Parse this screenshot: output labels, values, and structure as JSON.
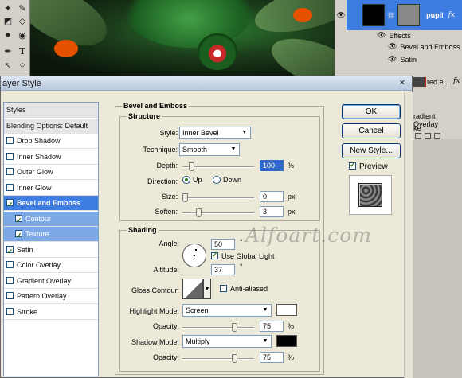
{
  "dialog": {
    "title": "ayer Style",
    "close_glyph": "✕"
  },
  "styles_list": [
    {
      "label": "Styles",
      "kind": "header"
    },
    {
      "label": "Blending Options: Default",
      "kind": "header"
    },
    {
      "label": "Drop Shadow",
      "checked": false
    },
    {
      "label": "Inner Shadow",
      "checked": false
    },
    {
      "label": "Outer Glow",
      "checked": false
    },
    {
      "label": "Inner Glow",
      "checked": false
    },
    {
      "label": "Bevel and Emboss",
      "checked": true,
      "kind": "active"
    },
    {
      "label": "Contour",
      "checked": true,
      "kind": "sub"
    },
    {
      "label": "Texture",
      "checked": true,
      "kind": "sub"
    },
    {
      "label": "Satin",
      "checked": true
    },
    {
      "label": "Color Overlay",
      "checked": false
    },
    {
      "label": "Gradient Overlay",
      "checked": false
    },
    {
      "label": "Pattern Overlay",
      "checked": false
    },
    {
      "label": "Stroke",
      "checked": false
    }
  ],
  "bevel": {
    "heading": "Bevel and Emboss",
    "structure_title": "Structure",
    "style_label": "Style:",
    "style_value": "Inner Bevel",
    "technique_label": "Technique:",
    "technique_value": "Smooth",
    "depth_label": "Depth:",
    "depth_value": "100",
    "depth_unit": "%",
    "depth_slider": 0.1,
    "direction_label": "Direction:",
    "up_label": "Up",
    "down_label": "Down",
    "size_label": "Size:",
    "size_value": "0",
    "size_unit": "px",
    "size_slider": 0.0,
    "soften_label": "Soften:",
    "soften_value": "3",
    "soften_unit": "px",
    "soften_slider": 0.2
  },
  "shading": {
    "title": "Shading",
    "angle_label": "Angle:",
    "angle_value": "50",
    "angle_unit": "°",
    "global_light_label": "Use Global Light",
    "altitude_label": "Altitude:",
    "altitude_value": "37",
    "altitude_unit": "°",
    "gloss_label": "Gloss Contour:",
    "anti_alias_label": "Anti-aliased",
    "highlight_label": "Highlight Mode:",
    "highlight_value": "Screen",
    "highlight_color": "#ffffff",
    "opacity_label": "Opacity:",
    "opacity_value": "75",
    "opacity_unit": "%",
    "opacity_slider": 0.75,
    "shadow_label": "Shadow Mode:",
    "shadow_value": "Multiply",
    "shadow_color": "#000000",
    "shadow_opacity_label": "Opacity:",
    "shadow_opacity_value": "75",
    "shadow_opacity_unit": "%",
    "shadow_opacity_slider": 0.75
  },
  "buttons": {
    "ok": "OK",
    "cancel": "Cancel",
    "new_style": "New Style...",
    "preview": "Preview"
  },
  "layers_panel": {
    "layer1": "pupil",
    "fx": "fx",
    "effects": "Effects",
    "effect1": "Bevel and Emboss",
    "effect2": "Satin",
    "layer2": "red e...",
    "gradient_overlay": "radient Overlay",
    "stroke": "ke"
  },
  "watermark": "Alfoart.com"
}
